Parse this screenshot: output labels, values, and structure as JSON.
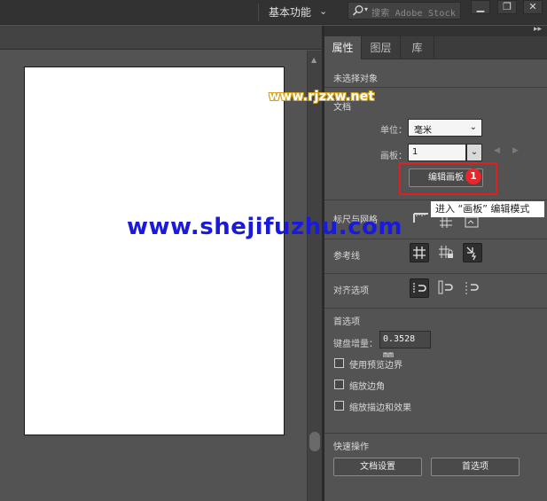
{
  "topbar": {
    "workspace_label": "基本功能",
    "search_placeholder": "搜索 Adobe Stock",
    "minimize": "▁",
    "restore": "❐",
    "close": "✕"
  },
  "panel": {
    "tabs": [
      {
        "label": "属性",
        "active": true
      },
      {
        "label": "图层",
        "active": false
      },
      {
        "label": "库",
        "active": false
      }
    ],
    "no_selection": "未选择对象",
    "document_section": "文档",
    "units_label": "单位：",
    "units_value": "毫米",
    "artboard_label": "画板：",
    "artboard_value": "1",
    "edit_artboards_button": "编辑画板",
    "badge": "1",
    "tooltip": "进入 “画板” 编辑模式",
    "rulers_grids": "标尺与网格",
    "guides": "参考线",
    "snap_options": "对齐选项",
    "preferences_section": "首选项",
    "keyboard_increment_label": "键盘增量：",
    "keyboard_increment_value": "0.3528 mm",
    "checkboxes": [
      {
        "label": "使用预览边界",
        "checked": false
      },
      {
        "label": "缩放边角",
        "checked": false
      },
      {
        "label": "缩放描边和效果",
        "checked": false
      }
    ],
    "quick_actions": "快速操作",
    "document_setup_button": "文档设置",
    "preferences_button": "首选项"
  },
  "watermarks": {
    "small": "www.rjzxw.net",
    "large": "www.shejifuzhu.com"
  },
  "colors": {
    "highlight": "#e02020",
    "badge": "#e8262b",
    "watermark_large": "#1a1adc",
    "panel_bg": "#535353"
  }
}
